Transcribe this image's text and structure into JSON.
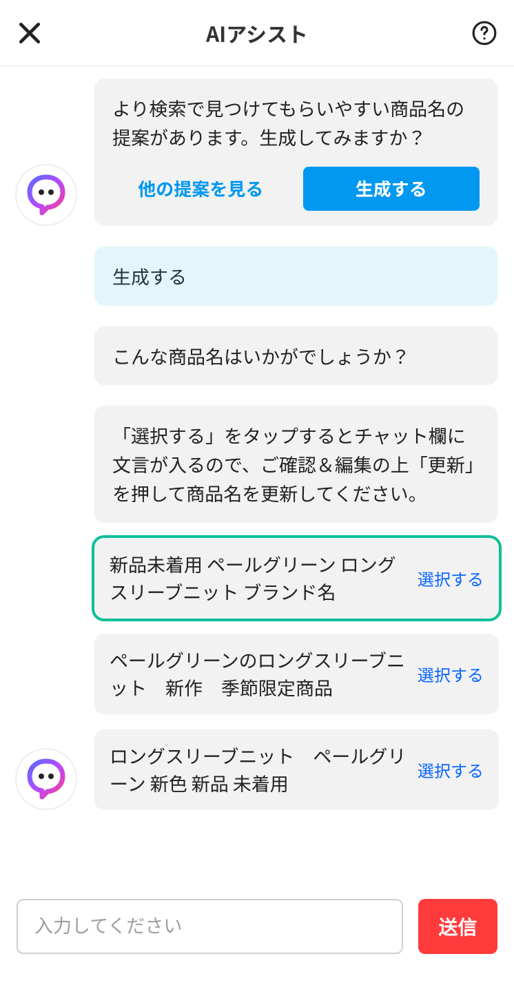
{
  "header": {
    "title": "AIアシスト"
  },
  "messages": {
    "assistant_prompt": "より検索で見つけてもらいやすい商品名の提案があります。生成してみますか？",
    "btn_secondary": "他の提案を見る",
    "btn_primary": "生成する",
    "user_reply": "生成する",
    "assistant_followup": "こんな商品名はいかがでしょうか？",
    "assistant_instructions": "「選択する」をタップするとチャット欄に文言が入るので、ご確認＆編集の上「更新」を押して商品名を更新してください。"
  },
  "suggestions": [
    {
      "text": "新品未着用 ペールグリーン ロングスリーブニット ブランド名",
      "select": "選択する",
      "highlight": true
    },
    {
      "text": "ペールグリーンのロングスリーブニット　新作　季節限定商品",
      "select": "選択する",
      "highlight": false
    },
    {
      "text": "ロングスリーブニット　ペールグリーン 新色 新品 未着用",
      "select": "選択する",
      "highlight": false
    }
  ],
  "input": {
    "placeholder": "入力してください",
    "send": "送信"
  }
}
